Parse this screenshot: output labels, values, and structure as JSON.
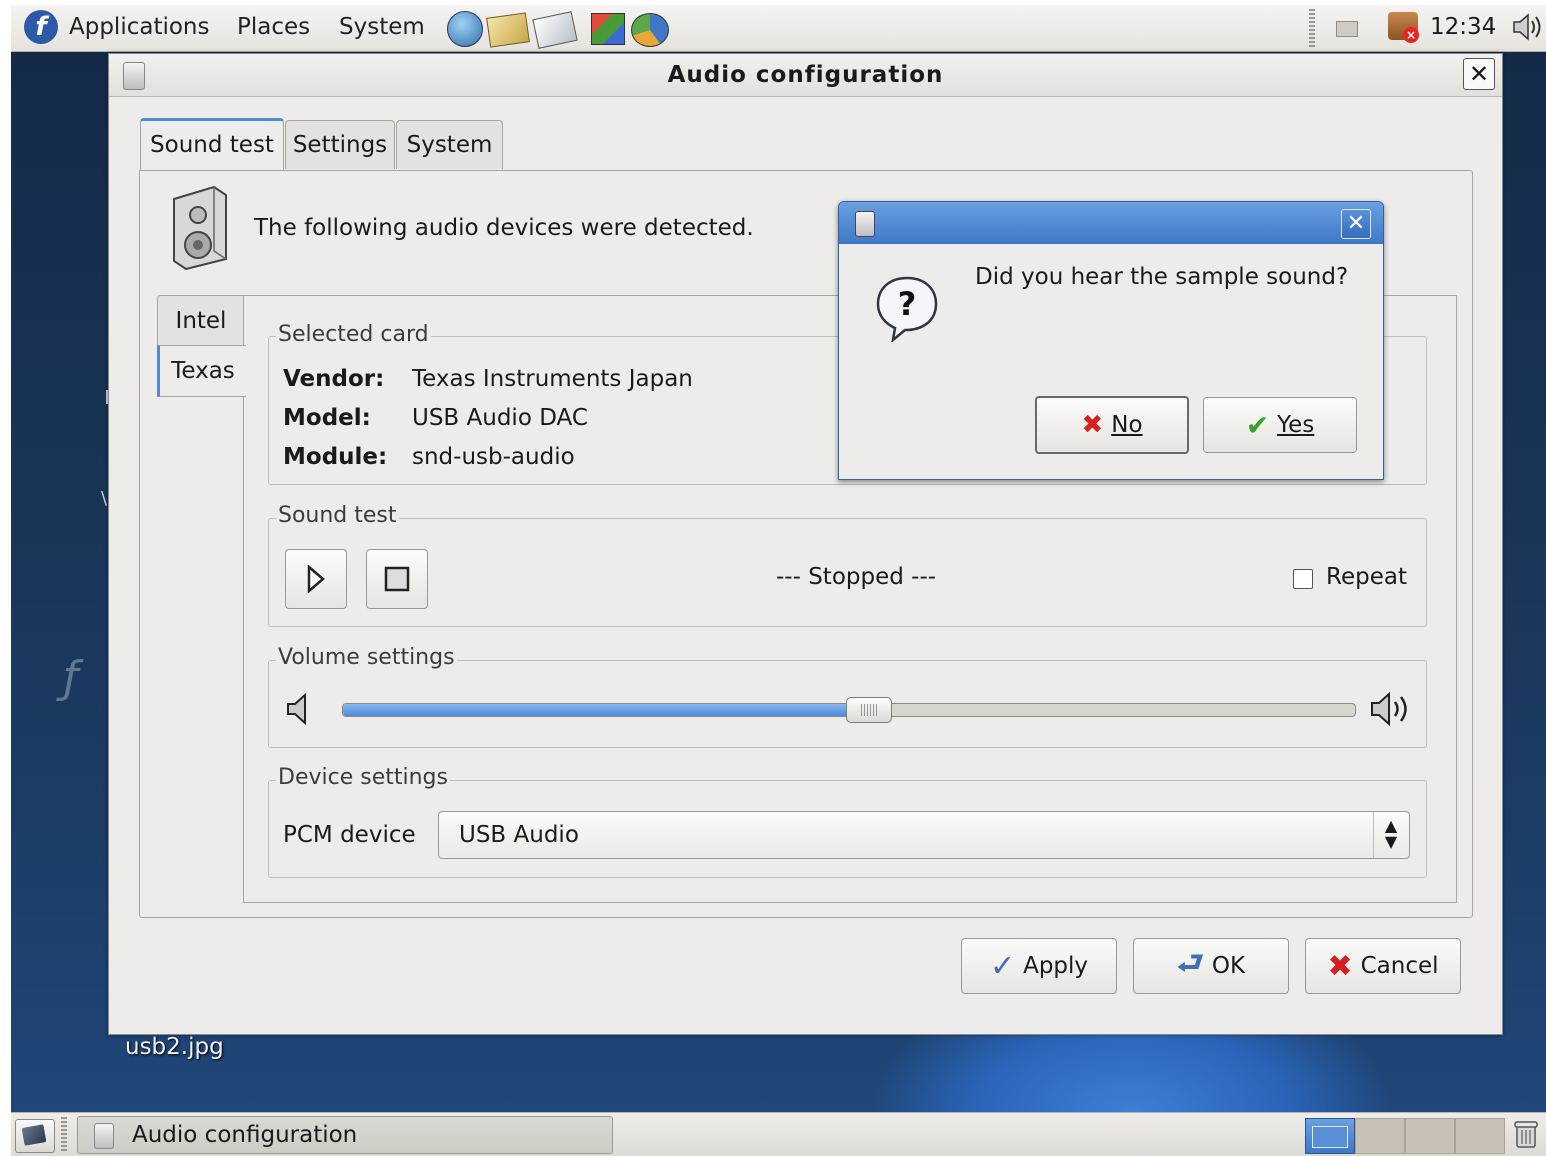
{
  "top_panel": {
    "menus": [
      "Applications",
      "Places",
      "System"
    ],
    "clock": "12:34"
  },
  "desktop": {
    "file_label": "usb2.jpg"
  },
  "taskbar": {
    "task_label": "Audio configuration"
  },
  "window": {
    "title": "Audio configuration",
    "tabs": [
      "Sound test",
      "Settings",
      "System"
    ],
    "intro_text": "The following audio devices were detected.",
    "card_tabs": [
      "Intel",
      "Texas"
    ],
    "selected_card": {
      "legend": "Selected card",
      "vendor_label": "Vendor:",
      "vendor": "Texas Instruments Japan",
      "model_label": "Model:",
      "model": "USB Audio DAC",
      "module_label": "Module:",
      "module": "snd-usb-audio"
    },
    "sound_test": {
      "legend": "Sound test",
      "status": "--- Stopped ---",
      "repeat_label": "Repeat",
      "repeat_checked": false
    },
    "volume": {
      "legend": "Volume settings",
      "level_fraction": 0.52
    },
    "device": {
      "legend": "Device settings",
      "pcm_label": "PCM device",
      "pcm_value": "USB Audio"
    },
    "buttons": {
      "apply": "Apply",
      "ok": "OK",
      "cancel": "Cancel"
    }
  },
  "question": {
    "text": "Did you hear the sample sound?",
    "no_label": "No",
    "yes_label": "Yes"
  },
  "colors": {
    "accent": "#4d8ad8",
    "title_blue": "#3f78c8",
    "no_red": "#d42020",
    "yes_green": "#3aa02a"
  }
}
